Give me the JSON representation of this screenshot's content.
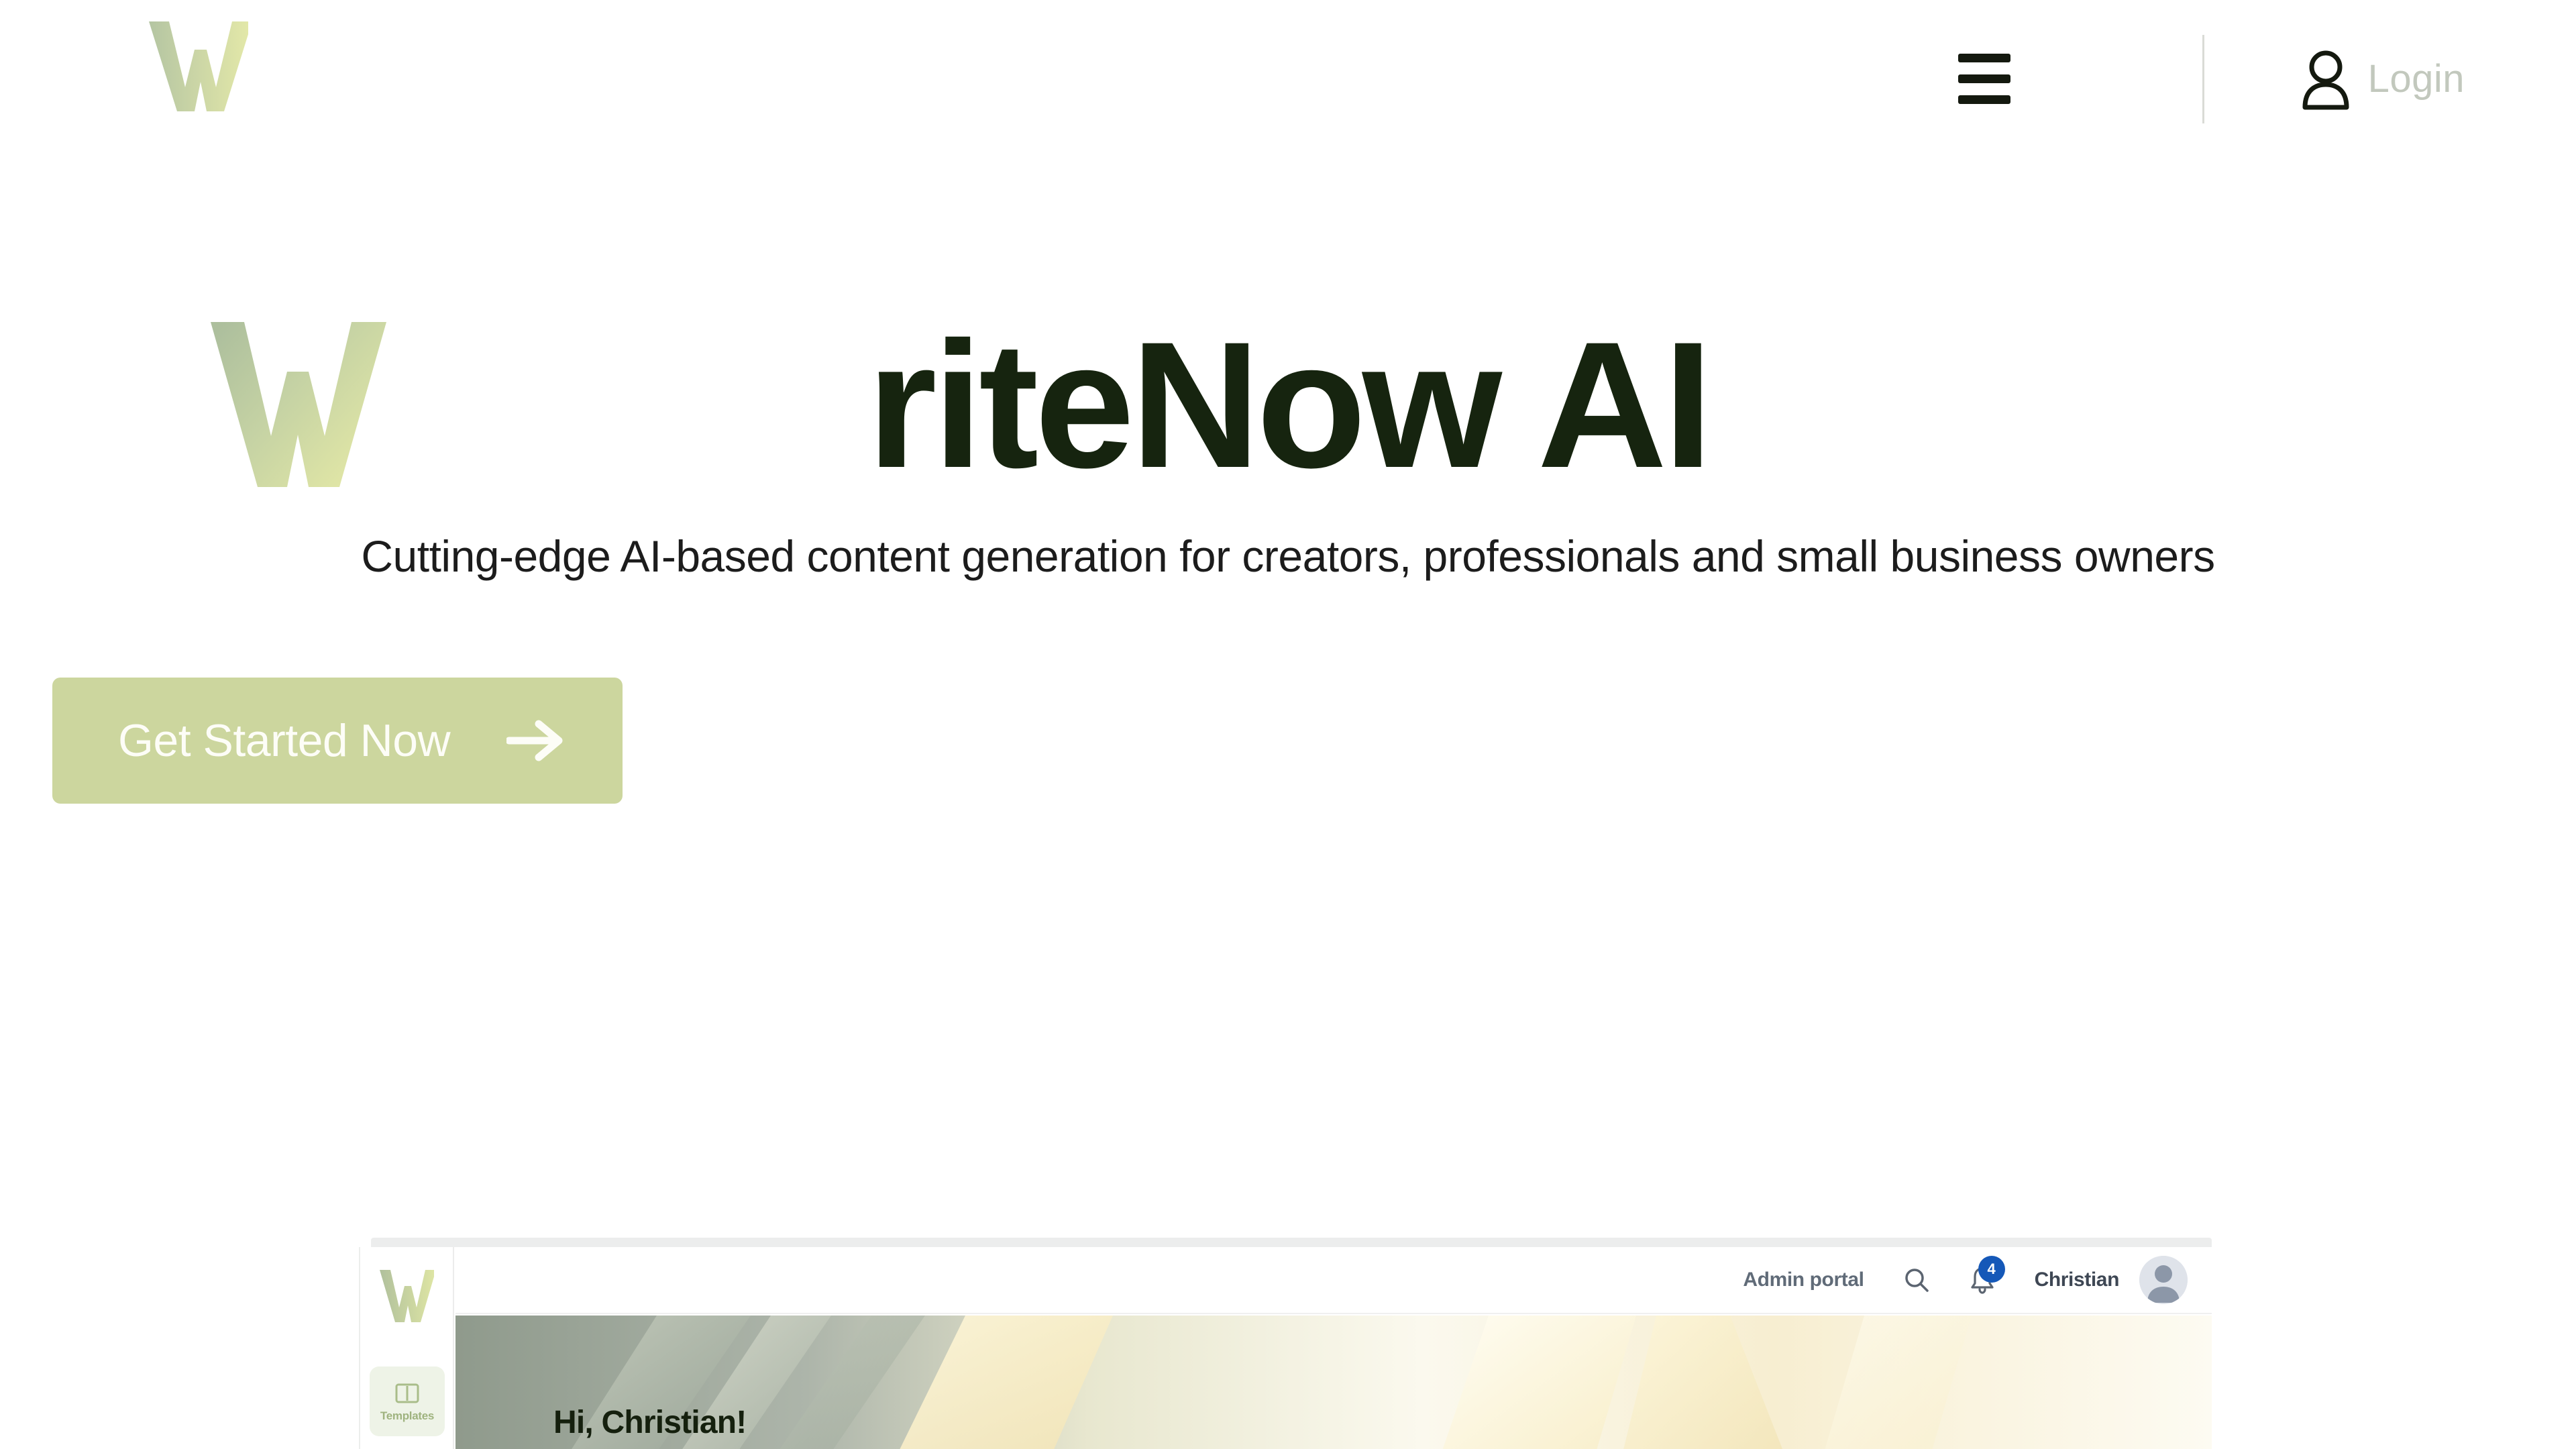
{
  "colors": {
    "brand_green": "#ccd69e",
    "logo_gradient_start": "#b7c6a3",
    "logo_gradient_end": "#e2e8a8",
    "title_dark": "#16240f",
    "cta_bg": "#ccd69e",
    "cta_text": "#fdfdf7",
    "login_text": "#c2c8bd",
    "badge_blue": "#1558b8"
  },
  "header": {
    "logo_icon": "w-logo-icon",
    "logo_alt": "W",
    "menu_icon": "hamburger-menu-icon",
    "account_icon": "user-account-icon",
    "login_label": "Login"
  },
  "hero": {
    "logo_icon": "w-logo-large-icon",
    "title": "riteNow AI",
    "subtitle": "Cutting-edge AI-based content generation for creators, professionals and small business owners",
    "cta_label": "Get Started Now",
    "cta_icon": "arrow-right-icon"
  },
  "app_preview": {
    "sidebar": {
      "logo_icon": "w-logo-icon",
      "items": [
        {
          "label": "Templates",
          "icon": "templates-book-icon",
          "active": true
        }
      ]
    },
    "topbar": {
      "admin_portal_label": "Admin portal",
      "search_icon": "search-icon",
      "notification_icon": "bell-icon",
      "notification_count": "4",
      "username": "Christian",
      "avatar_icon": "avatar-icon"
    },
    "banner": {
      "greeting": "Hi, Christian!"
    }
  }
}
